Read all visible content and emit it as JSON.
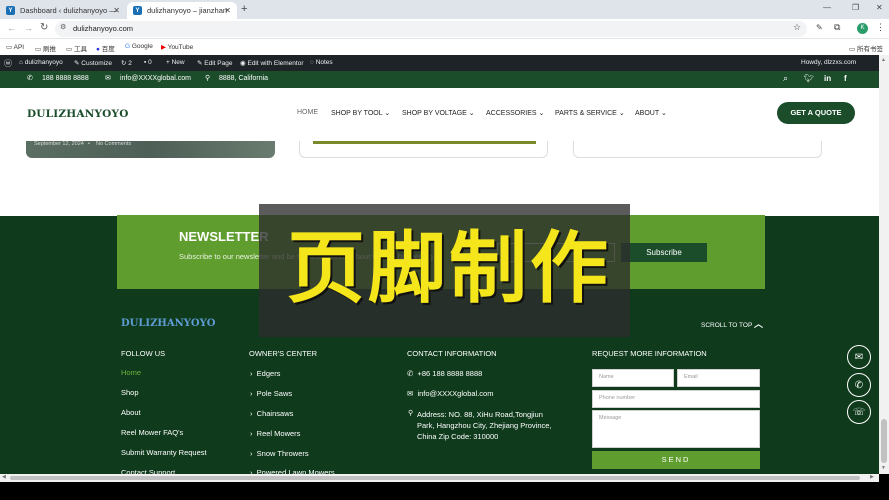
{
  "browser": {
    "tabs": [
      {
        "title": "Dashboard ‹ dulizhanyoyo —",
        "favicon": "Y"
      },
      {
        "title": "dulizhanyoyo – jianzhanjiaoç",
        "favicon": "Y"
      }
    ],
    "url": "dulizhanyoyo.com",
    "bookmarks": [
      "API",
      "刷推",
      "工具",
      "百度",
      "Google",
      "YouTube"
    ],
    "all_bookmarks": "所有书签",
    "profile_initial": "K"
  },
  "wp_admin": {
    "site_name": "dulizhanyoyo",
    "customize": "Customize",
    "updates": "2",
    "comments": "0",
    "new": "New",
    "edit_page": "Edit Page",
    "elementor": "Edit with Elementor",
    "notes": "Notes",
    "howdy": "Howdy, dlzzxs.com"
  },
  "topbar": {
    "phone": "188 8888 8888",
    "email": "info@XXXXglobal.com",
    "location": "8888, California"
  },
  "header": {
    "logo": "DULIZHANYOYO",
    "nav": [
      "HOME",
      "SHOP BY TOOL",
      "SHOP BY VOLTAGE",
      "ACCESSORIES",
      "PARTS & SERVICE",
      "ABOUT"
    ],
    "cta": "GET A QUOTE"
  },
  "post_card": {
    "date": "September 12, 2024",
    "comments": "No Comments"
  },
  "newsletter": {
    "title": "NEWSLETTER",
    "text": "Subscribe to our newsletter and be the first to know about what is happening",
    "button": "Subscribe"
  },
  "overlay": {
    "caption": "页脚制作"
  },
  "footer": {
    "logo": "DULIZHANYOYO",
    "scroll_top": "SCROLL TO TOP",
    "follow": {
      "heading": "FOLLOW US",
      "links": [
        "Home",
        "Shop",
        "About",
        "Reel Mower FAQ's",
        "Submit Warranty Request",
        "Contact Support"
      ]
    },
    "owners": {
      "heading": "OWNER'S CENTER",
      "links": [
        "Edgers",
        "Pole Saws",
        "Chainsaws",
        "Reel Mowers",
        "Snow Throwers",
        "Powered Lawn Mowers"
      ]
    },
    "contact": {
      "heading": "CONTACT INFORMATION",
      "phone": "+86 188 8888 8888",
      "email": "info@XXXXglobal.com",
      "address": "Address: NO. 88, XiHu Road,Tongjiun Park, Hangzhou City, Zhejiang Province, China Zip Code: 310000"
    },
    "request": {
      "heading": "REQUEST MORE INFORMATION",
      "name_ph": "Name",
      "email_ph": "Email",
      "phone_ph": "Phone number",
      "message_ph": "Message",
      "send": "SEND"
    }
  },
  "colors": {
    "footer_bg": "#0f3a1c",
    "newsletter_bg": "#5f9d2f",
    "accent_green": "#5f9d2f",
    "overlay_text": "#f5e61c"
  }
}
